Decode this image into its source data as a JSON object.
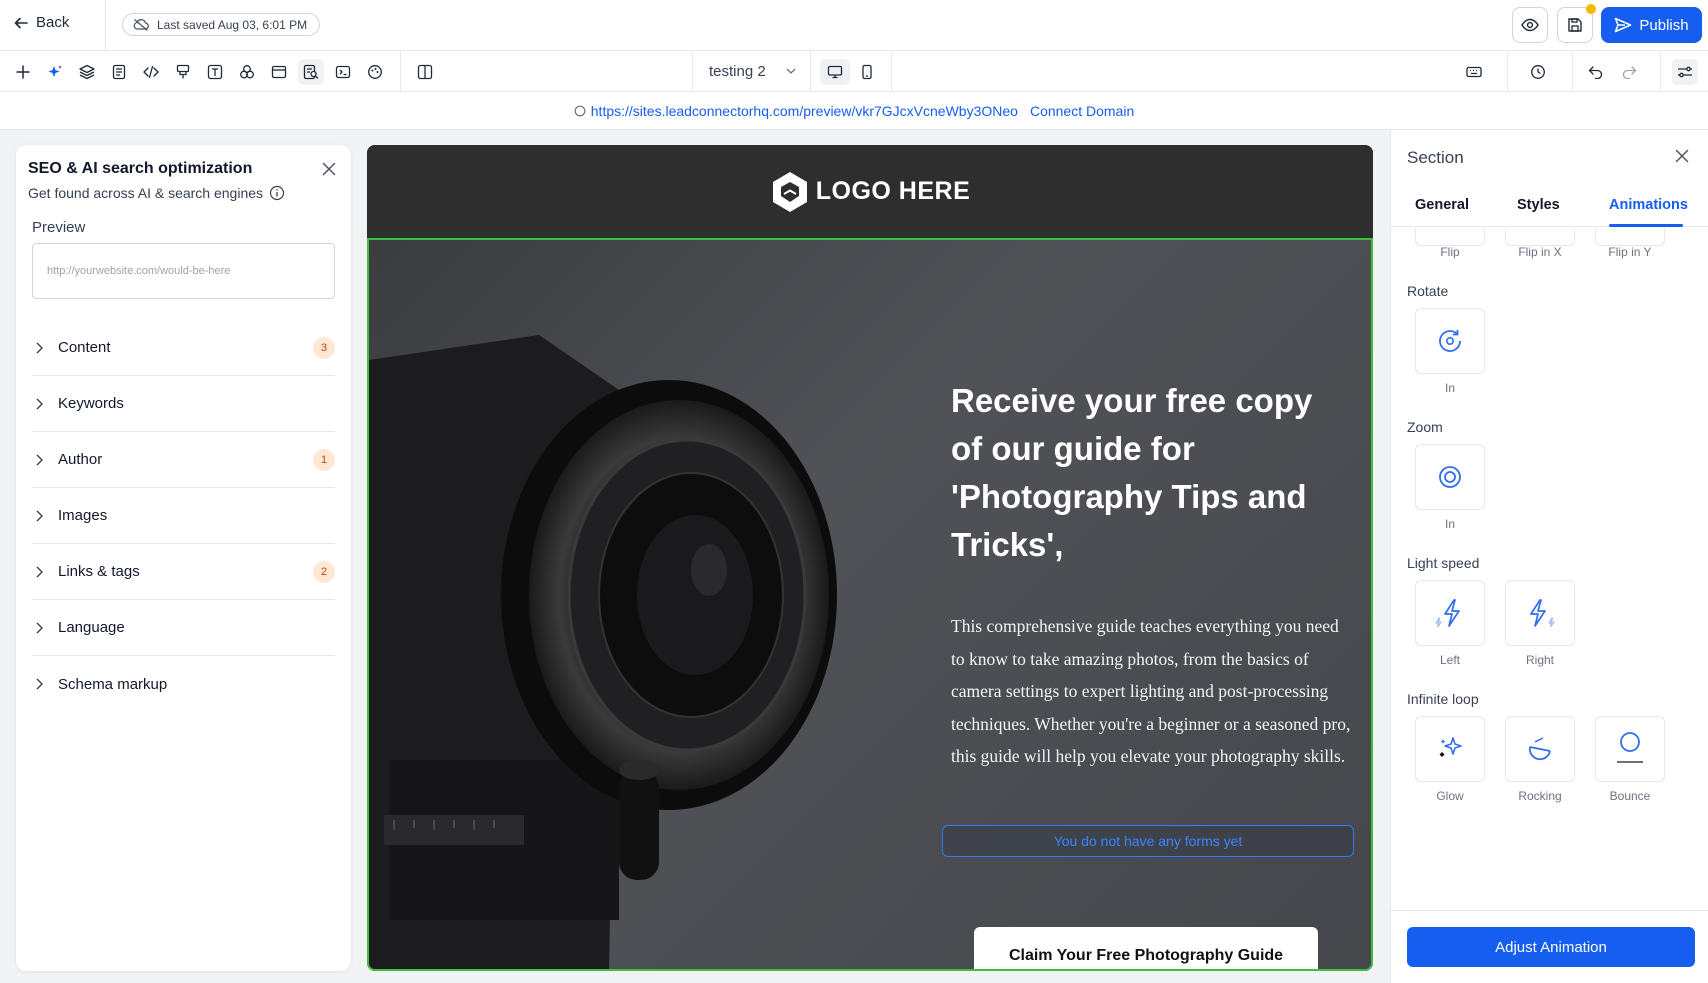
{
  "topbar": {
    "back_label": "Back",
    "saved_label": "Last saved Aug 03, 6:01 PM",
    "publish_label": "Publish"
  },
  "toolbar": {
    "icons": [
      "plus-icon",
      "ai-sparkle-icon",
      "layers-icon",
      "pages-icon",
      "code-icon",
      "paint-icon",
      "text-icon",
      "components-icon",
      "layout-icon",
      "seo-icon",
      "terminal-icon",
      "theme-icon",
      "split-view-icon"
    ],
    "page_select_value": "testing 2"
  },
  "urlbar": {
    "url": "https://sites.leadconnectorhq.com/preview/vkr7GJcxVcneWby3ONeo",
    "connect_label": "Connect Domain"
  },
  "seo_panel": {
    "title": "SEO & AI search optimization",
    "subtitle": "Get found across AI & search engines",
    "preview_label": "Preview",
    "preview_placeholder": "http://yourwebsite.com/would-be-here",
    "items": [
      {
        "label": "Content",
        "badge": "3"
      },
      {
        "label": "Keywords",
        "badge": ""
      },
      {
        "label": "Author",
        "badge": "1"
      },
      {
        "label": "Images",
        "badge": ""
      },
      {
        "label": "Links & tags",
        "badge": "2"
      },
      {
        "label": "Language",
        "badge": ""
      },
      {
        "label": "Schema markup",
        "badge": ""
      }
    ]
  },
  "canvas": {
    "logo_text": "LOGO HERE",
    "headline": "Receive your free copy of our guide for 'Photography Tips and Tricks',",
    "body": "This comprehensive guide teaches everything you need to know to take amazing photos, from the basics of camera settings to expert lighting and post-processing techniques. Whether you're a beginner or a seasoned pro, this guide will help you elevate your photography skills.",
    "forms_note": "You do not have any forms yet",
    "cta_label": "Claim Your Free Photography Guide",
    "highlight_color": "#3fbf3f"
  },
  "right_panel": {
    "title": "Section",
    "tabs": [
      "General",
      "Styles",
      "Animations"
    ],
    "active_tab": "Animations",
    "flip_labels": [
      "Flip",
      "Flip in X",
      "Flip in Y"
    ],
    "rotate": {
      "label": "Rotate",
      "items": [
        "In"
      ]
    },
    "zoom": {
      "label": "Zoom",
      "items": [
        "In"
      ]
    },
    "light_speed": {
      "label": "Light speed",
      "items": [
        "Left",
        "Right"
      ]
    },
    "infinite_loop": {
      "label": "Infinite loop",
      "items": [
        "Glow",
        "Rocking",
        "Bounce"
      ]
    },
    "adjust_label": "Adjust Animation",
    "accent_color": "#155eef"
  }
}
